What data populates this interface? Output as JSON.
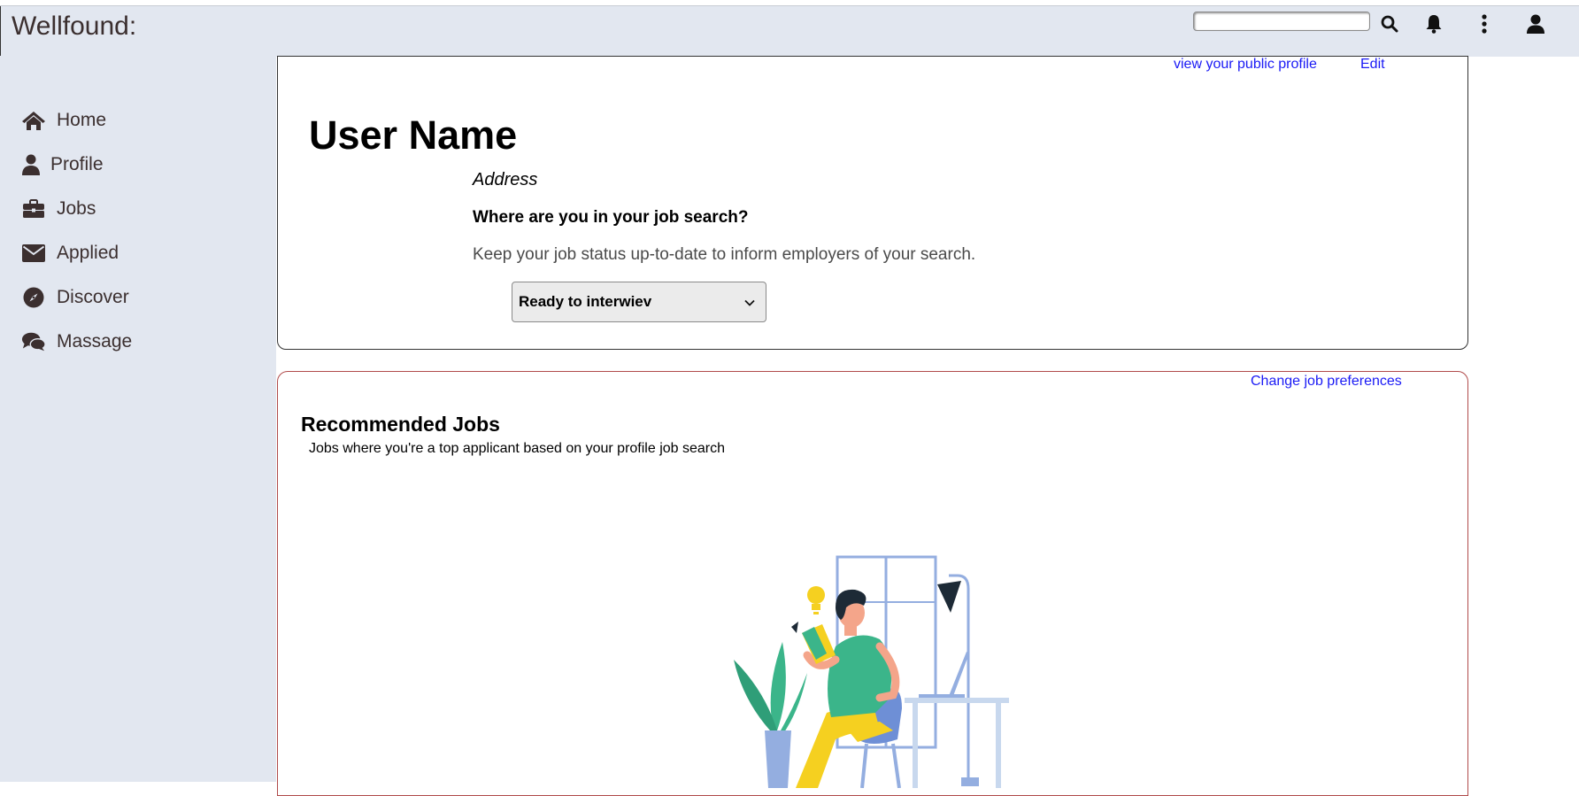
{
  "header": {
    "brand": "Wellfound:",
    "search": {
      "value": "",
      "placeholder": ""
    },
    "icons": [
      "search-icon",
      "bell-icon",
      "more-vertical-icon",
      "user-icon"
    ]
  },
  "sidebar": {
    "items": [
      {
        "label": "Home",
        "icon": "home-icon"
      },
      {
        "label": "Profile",
        "icon": "user-icon"
      },
      {
        "label": "Jobs",
        "icon": "briefcase-icon"
      },
      {
        "label": "Applied",
        "icon": "envelope-icon"
      },
      {
        "label": "Discover",
        "icon": "compass-icon"
      },
      {
        "label": "Massage",
        "icon": "chat-icon"
      }
    ]
  },
  "profile": {
    "view_public_link": "view your public profile",
    "edit_link": "Edit",
    "name": "User Name",
    "address": "Address",
    "question": "Where are you in your job search?",
    "hint": "Keep your job status up-to-date to inform employers of your search.",
    "status_selected": "Ready to interwiev"
  },
  "recommended": {
    "change_link": "Change job preferences",
    "title": "Recommended Jobs",
    "subtitle": "Jobs where you're a top applicant based on your profile job search"
  },
  "colors": {
    "chrome_bg": "#e2e7f0",
    "text_dark": "#3b2f2f",
    "link": "#1a1af5",
    "card2_border": "#b04a4a"
  }
}
